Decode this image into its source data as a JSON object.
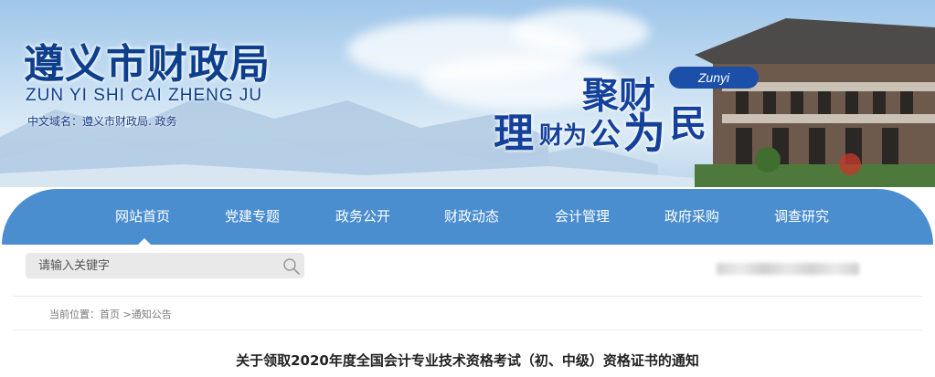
{
  "header": {
    "site_title": "遵义市财政局",
    "site_pinyin": "ZUN YI SHI CAI ZHENG JU",
    "domain_label": "中文域名：遵义市财政局. 政务",
    "slogan": {
      "line1": "聚财",
      "pill": "Zunyi",
      "line2_a": "理",
      "line2_b": "财为",
      "line2_c": "公",
      "line2_d": "为",
      "line2_e": "民"
    }
  },
  "nav": {
    "items": [
      "网站首页",
      "党建专题",
      "政务公开",
      "财政动态",
      "会计管理",
      "政府采购",
      "调查研究"
    ],
    "active_index": 0
  },
  "search": {
    "placeholder": "请输入关键字",
    "icon": "magnifier-icon"
  },
  "breadcrumb": {
    "label": "当前位置：",
    "home": "首页",
    "separator": " >",
    "current": "通知公告"
  },
  "article": {
    "title": "关于领取2020年度全国会计专业技术资格考试（初、中级）资格证书的通知"
  },
  "colors": {
    "nav_bg": "#4a8ed0",
    "title_blue": "#0d3f8c",
    "search_bg": "#e9e9e9"
  }
}
